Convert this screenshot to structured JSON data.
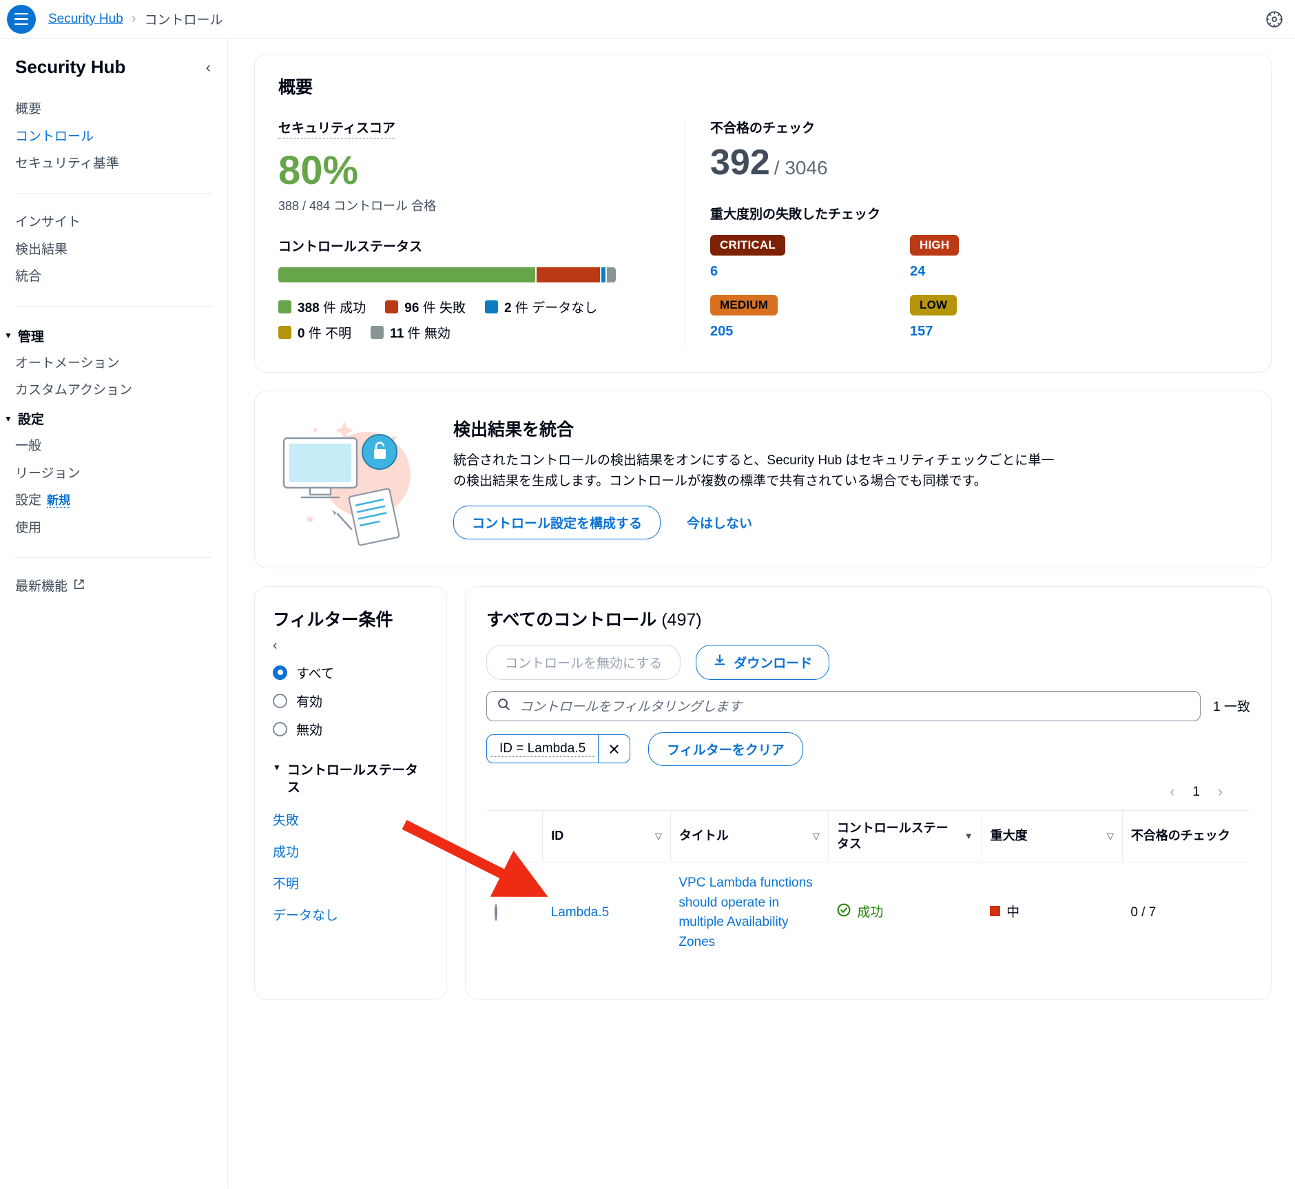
{
  "topbar": {
    "menu_icon": "hamburger-icon",
    "breadcrumb_root": "Security Hub",
    "breadcrumb_sep": "›",
    "breadcrumb_current": "コントロール",
    "settings_icon": "gear-icon"
  },
  "sidebar": {
    "title": "Security Hub",
    "collapse_icon": "‹",
    "items": [
      {
        "label": "概要",
        "active": false
      },
      {
        "label": "コントロール",
        "active": true
      },
      {
        "label": "セキュリティ基準",
        "active": false
      },
      {
        "label": "インサイト",
        "active": false
      },
      {
        "label": "検出結果",
        "active": false
      },
      {
        "label": "統合",
        "active": false
      }
    ],
    "group_manage": "管理",
    "manage_items": [
      {
        "label": "オートメーション"
      },
      {
        "label": "カスタムアクション"
      }
    ],
    "group_settings": "設定",
    "settings_items": [
      {
        "label": "一般",
        "badge": ""
      },
      {
        "label": "リージョン",
        "badge": ""
      },
      {
        "label": "設定",
        "badge": "新規"
      },
      {
        "label": "使用",
        "badge": ""
      }
    ],
    "whatsnew": "最新機能",
    "whatsnew_icon": "external-link-icon",
    "caret": "▼"
  },
  "overview": {
    "title": "概要",
    "score_label": "セキュリティスコア",
    "score_value": "80%",
    "score_color": "#67a54b",
    "score_sub": "388 / 484 コントロール 合格",
    "status_label": "コントロールステータス",
    "failed_label": "不合格のチェック",
    "failed_value": "392",
    "failed_total": "/ 3046",
    "severity_label": "重大度別の失敗したチェック"
  },
  "chart_data": {
    "type": "bar",
    "title": "コントロールステータス",
    "orientation": "horizontal-stacked",
    "categories": [
      "成功",
      "失敗",
      "データなし",
      "不明",
      "無効"
    ],
    "values": [
      388,
      96,
      2,
      0,
      11
    ],
    "colors": [
      "#67a54b",
      "#ba3a16",
      "#0d7dc1",
      "#b7950b",
      "#879596"
    ],
    "legend": [
      {
        "count": "388",
        "unit": "件",
        "label": "成功",
        "color": "#67a54b"
      },
      {
        "count": "96",
        "unit": "件",
        "label": "失敗",
        "color": "#ba3a16"
      },
      {
        "count": "2",
        "unit": "件",
        "label": "データなし",
        "color": "#0d7dc1"
      },
      {
        "count": "0",
        "unit": "件",
        "label": "不明",
        "color": "#b7950b"
      },
      {
        "count": "11",
        "unit": "件",
        "label": "無効",
        "color": "#879596"
      }
    ],
    "total": 497,
    "legend_position": "below"
  },
  "severities": [
    {
      "name": "CRITICAL",
      "count": "6",
      "bg": "#7d2105",
      "fg": "#ffffff"
    },
    {
      "name": "HIGH",
      "count": "24",
      "bg": "#ba3a16",
      "fg": "#ffffff"
    },
    {
      "name": "MEDIUM",
      "count": "205",
      "bg": "#d8711f",
      "fg": "#000716"
    },
    {
      "name": "LOW",
      "count": "157",
      "bg": "#b7950b",
      "fg": "#000716"
    }
  ],
  "consolidated": {
    "title": "検出結果を統合",
    "desc_line1": "統合されたコントロールの検出結果をオンにすると、Security Hub はセキュリティチェックごとに単一",
    "desc_line2": "の検出結果を生成します。コントロールが複数の標準で共有されている場合でも同様です。",
    "primary_btn": "コントロール設定を構成する",
    "secondary_link": "今はしない",
    "illustration_icon": "lock-monitor-illustration"
  },
  "filters": {
    "title": "フィルター条件",
    "collapse_icon": "‹",
    "radios": [
      {
        "label": "すべて",
        "selected": true
      },
      {
        "label": "有効",
        "selected": false
      },
      {
        "label": "無効",
        "selected": false
      }
    ],
    "group_caret": "▼",
    "group_label": "コントロールステータス",
    "links": [
      "失敗",
      "成功",
      "不明",
      "データなし"
    ]
  },
  "table": {
    "heading": "すべてのコントロール",
    "heading_count": "(497)",
    "disable_btn": "コントロールを無効にする",
    "download_btn": "ダウンロード",
    "download_icon": "download-icon",
    "search_icon": "search-icon",
    "search_placeholder": "コントロールをフィルタリングします",
    "search_value": "",
    "match_count": "1 一致",
    "chip_label": "ID = Lambda.5",
    "chip_close_icon": "close-icon",
    "clear_btn": "フィルターをクリア",
    "pager_prev": "‹",
    "pager_page": "1",
    "pager_next": "›",
    "columns": [
      {
        "label": "",
        "sort": ""
      },
      {
        "label": "ID",
        "sort": "▽"
      },
      {
        "label": "タイトル",
        "sort": "▽"
      },
      {
        "label": "コントロールステータス",
        "sort": "▼"
      },
      {
        "label": "重大度",
        "sort": "▽"
      },
      {
        "label": "不合格のチェック",
        "sort": ""
      }
    ],
    "rows": [
      {
        "id": "Lambda.5",
        "title": "VPC Lambda functions should operate in multiple Availability Zones",
        "status": "成功",
        "status_icon": "check-circle-icon",
        "severity": "中",
        "failed_checks": "0 / 7"
      }
    ]
  },
  "annotation": {
    "arrow_color": "#ee2c16",
    "arrow_icon": "pointer-arrow"
  }
}
